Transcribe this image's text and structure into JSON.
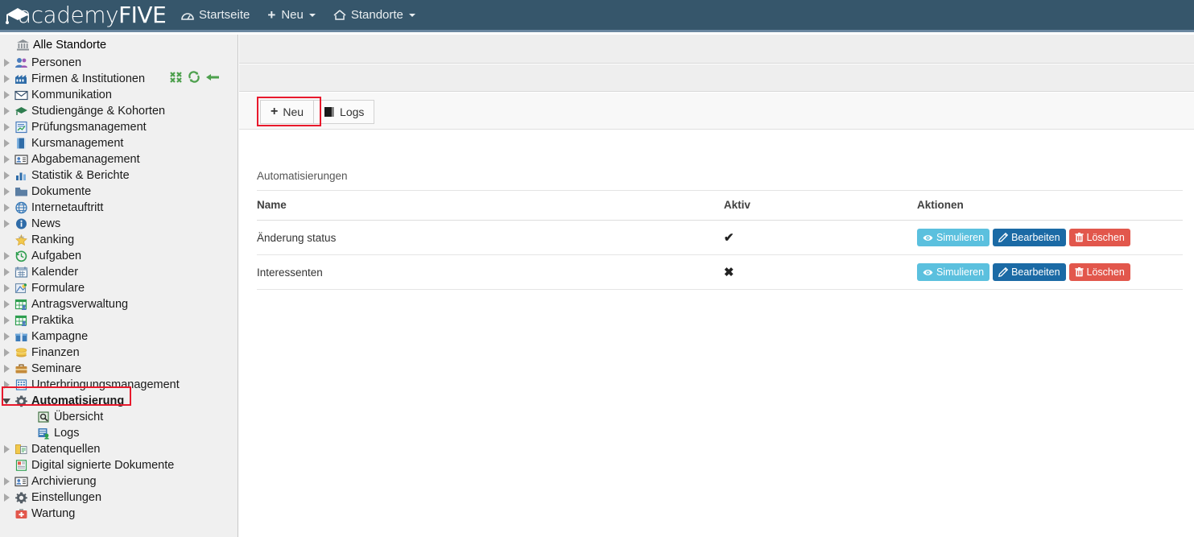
{
  "app": {
    "brand_prefix": "academy",
    "brand_suffix": "FIVE",
    "brand_icon": "graduation-cap-icon",
    "header_bg": "#36566b",
    "header_border": "#6b87a0"
  },
  "topnav": {
    "items": [
      {
        "label": "Startseite",
        "icon": "dashboard-icon",
        "caret": false
      },
      {
        "label": "Neu",
        "icon": "plus-icon",
        "caret": true
      },
      {
        "label": "Standorte",
        "icon": "home-icon",
        "caret": true
      }
    ]
  },
  "sidebar": {
    "header": {
      "label": "Alle Standorte",
      "icon": "bank-icon"
    },
    "header_tools": [
      {
        "name": "collapse-all-icon",
        "color": "#4da04d"
      },
      {
        "name": "refresh-icon",
        "color": "#4da04d"
      },
      {
        "name": "back-arrow-icon",
        "color": "#4da04d"
      }
    ],
    "items": [
      {
        "label": "Personen",
        "icon": "users-icon",
        "arrow": "closed",
        "level": 0
      },
      {
        "label": "Firmen & Institutionen",
        "icon": "factory-icon",
        "arrow": "closed",
        "level": 0
      },
      {
        "label": "Kommunikation",
        "icon": "envelope-icon",
        "arrow": "closed",
        "level": 0
      },
      {
        "label": "Studiengänge & Kohorten",
        "icon": "graduation-cap-icon",
        "arrow": "closed",
        "level": 0
      },
      {
        "label": "Prüfungsmanagement",
        "icon": "exam-sheet-icon",
        "arrow": "closed",
        "level": 0
      },
      {
        "label": "Kursmanagement",
        "icon": "book-icon",
        "arrow": "closed",
        "level": 0
      },
      {
        "label": "Abgabemanagement",
        "icon": "id-card-icon",
        "arrow": "closed",
        "level": 0
      },
      {
        "label": "Statistik & Berichte",
        "icon": "bar-chart-icon",
        "arrow": "closed",
        "level": 0
      },
      {
        "label": "Dokumente",
        "icon": "folder-icon",
        "arrow": "closed",
        "level": 0
      },
      {
        "label": "Internetauftritt",
        "icon": "globe-icon",
        "arrow": "closed",
        "level": 0
      },
      {
        "label": "News",
        "icon": "info-icon",
        "arrow": "closed",
        "level": 0
      },
      {
        "label": "Ranking",
        "icon": "star-icon",
        "arrow": "none",
        "level": 0
      },
      {
        "label": "Aufgaben",
        "icon": "clock-history-icon",
        "arrow": "closed",
        "level": 0
      },
      {
        "label": "Kalender",
        "icon": "calendar-icon",
        "arrow": "closed",
        "level": 0
      },
      {
        "label": "Formulare",
        "icon": "form-icon",
        "arrow": "closed",
        "level": 0
      },
      {
        "label": "Antragsverwaltung",
        "icon": "table-user-icon",
        "arrow": "closed",
        "level": 0
      },
      {
        "label": "Praktika",
        "icon": "table-user-icon",
        "arrow": "closed",
        "level": 0
      },
      {
        "label": "Kampagne",
        "icon": "gift-icon",
        "arrow": "closed",
        "level": 0
      },
      {
        "label": "Finanzen",
        "icon": "coins-icon",
        "arrow": "closed",
        "level": 0
      },
      {
        "label": "Seminare",
        "icon": "briefcase-icon",
        "arrow": "closed",
        "level": 0
      },
      {
        "label": "Unterbringungsmanagement",
        "icon": "building-icon",
        "arrow": "closed",
        "level": 0
      },
      {
        "label": "Automatisierung",
        "icon": "gear-icon",
        "arrow": "open",
        "level": 0,
        "active": true,
        "highlighted": true
      },
      {
        "label": "Übersicht",
        "icon": "magnifier-page-icon",
        "arrow": "none",
        "level": 1
      },
      {
        "label": "Logs",
        "icon": "logs-icon",
        "arrow": "none",
        "level": 1
      },
      {
        "label": "Datenquellen",
        "icon": "data-source-icon",
        "arrow": "closed",
        "level": 0
      },
      {
        "label": "Digital signierte Dokumente",
        "icon": "signed-document-icon",
        "arrow": "none",
        "level": 0
      },
      {
        "label": "Archivierung",
        "icon": "id-card-icon",
        "arrow": "closed",
        "level": 0
      },
      {
        "label": "Einstellungen",
        "icon": "gear-icon",
        "arrow": "closed",
        "level": 0
      },
      {
        "label": "Wartung",
        "icon": "first-aid-icon",
        "arrow": "none",
        "level": 0
      }
    ]
  },
  "toolbar": {
    "new_label": "Neu",
    "new_icon": "plus-icon",
    "logs_label": "Logs",
    "logs_icon": "book-black-icon"
  },
  "panel": {
    "title": "Automatisierungen",
    "columns": [
      "Name",
      "Aktiv",
      "Aktionen"
    ],
    "rows": [
      {
        "name": "Änderung status",
        "aktiv": "✔",
        "aktiv_state": "true",
        "actions": [
          {
            "label": "Simulieren",
            "icon": "eye-icon",
            "style": "sim"
          },
          {
            "label": "Bearbeiten",
            "icon": "pencil-icon",
            "style": "edit"
          },
          {
            "label": "Löschen",
            "icon": "trash-icon",
            "style": "del"
          }
        ]
      },
      {
        "name": "Interessenten",
        "aktiv": "✖",
        "aktiv_state": "false",
        "actions": [
          {
            "label": "Simulieren",
            "icon": "eye-icon",
            "style": "sim"
          },
          {
            "label": "Bearbeiten",
            "icon": "pencil-icon",
            "style": "edit"
          },
          {
            "label": "Löschen",
            "icon": "trash-icon",
            "style": "del"
          }
        ]
      }
    ]
  },
  "highlights": {
    "color": "#e8192c",
    "boxes": [
      "sidebar-automatisierung",
      "toolbar-neu-button"
    ]
  }
}
